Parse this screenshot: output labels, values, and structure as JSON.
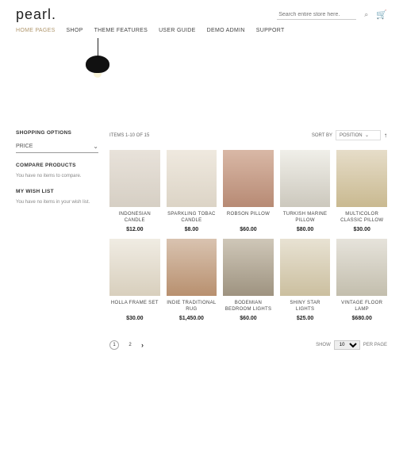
{
  "header": {
    "logo": "pearl.",
    "search_placeholder": "Search entire store here...",
    "nav": [
      "HOME PAGES",
      "SHOP",
      "THEME FEATURES",
      "USER GUIDE",
      "DEMO ADMIN",
      "SUPPORT"
    ]
  },
  "sidebar": {
    "shopping_title": "SHOPPING OPTIONS",
    "price_label": "PRICE",
    "compare_title": "COMPARE PRODUCTS",
    "compare_text": "You have no items to compare.",
    "wishlist_title": "MY WISH LIST",
    "wishlist_text": "You have no items in your wish list."
  },
  "toolbar": {
    "count": "ITEMS 1-10 OF 15",
    "sort_label": "SORT BY",
    "sort_value": "POSITION"
  },
  "products": [
    {
      "name": "INDONESIAN CANDLE",
      "price": "$12.00",
      "img": "t1"
    },
    {
      "name": "SPARKLING TOBAC CANDLE",
      "price": "$8.00",
      "img": "t2"
    },
    {
      "name": "ROBSON PILLOW",
      "price": "$60.00",
      "img": "t3"
    },
    {
      "name": "TURKISH MARINE PILLOW",
      "price": "$80.00",
      "img": "t4"
    },
    {
      "name": "MULTICOLOR CLASSIC PILLOW",
      "price": "$30.00",
      "img": "t5"
    },
    {
      "name": "HOLLA FRAME SET",
      "price": "$30.00",
      "img": "t6"
    },
    {
      "name": "INDIE TRADITIONAL RUG",
      "price": "$1,450.00",
      "img": "t7"
    },
    {
      "name": "BODEMIAN BEDROOM LIGHTS",
      "price": "$60.00",
      "img": "t8"
    },
    {
      "name": "SHINY STAR LIGHTS",
      "price": "$25.00",
      "img": "t9"
    },
    {
      "name": "VINTAGE FLOOR LAMP",
      "price": "$680.00",
      "img": "t10"
    }
  ],
  "pagination": {
    "pages": [
      "1",
      "2"
    ],
    "current": 0
  },
  "show": {
    "label": "SHOW",
    "value": "10",
    "suffix": "PER PAGE"
  }
}
